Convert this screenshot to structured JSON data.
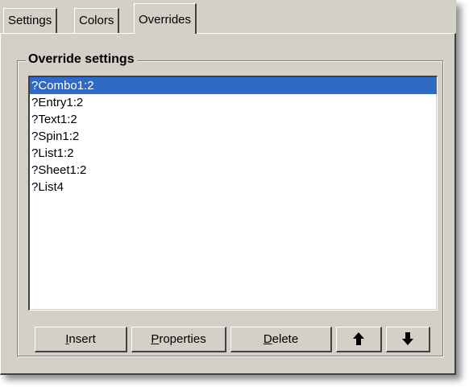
{
  "tabs": {
    "settings": "Settings",
    "colors": "Colors",
    "overrides": "Overrides"
  },
  "group": {
    "title": "Override settings"
  },
  "list": {
    "items": [
      "?Combo1:2",
      "?Entry1:2",
      "?Text1:2",
      "?Spin1:2",
      "?List1:2",
      "?Sheet1:2",
      "?List4"
    ],
    "selected_index": 0
  },
  "buttons": {
    "insert": {
      "accel": "I",
      "rest": "nsert"
    },
    "properties": {
      "accel": "P",
      "rest": "roperties"
    },
    "delete": {
      "accel": "D",
      "rest": "elete"
    },
    "move_up_icon": "arrow-up-icon",
    "move_down_icon": "arrow-down-icon"
  },
  "colors": {
    "face": "#d4d0c8",
    "selection": "#316ac5",
    "shadow": "#404040"
  }
}
